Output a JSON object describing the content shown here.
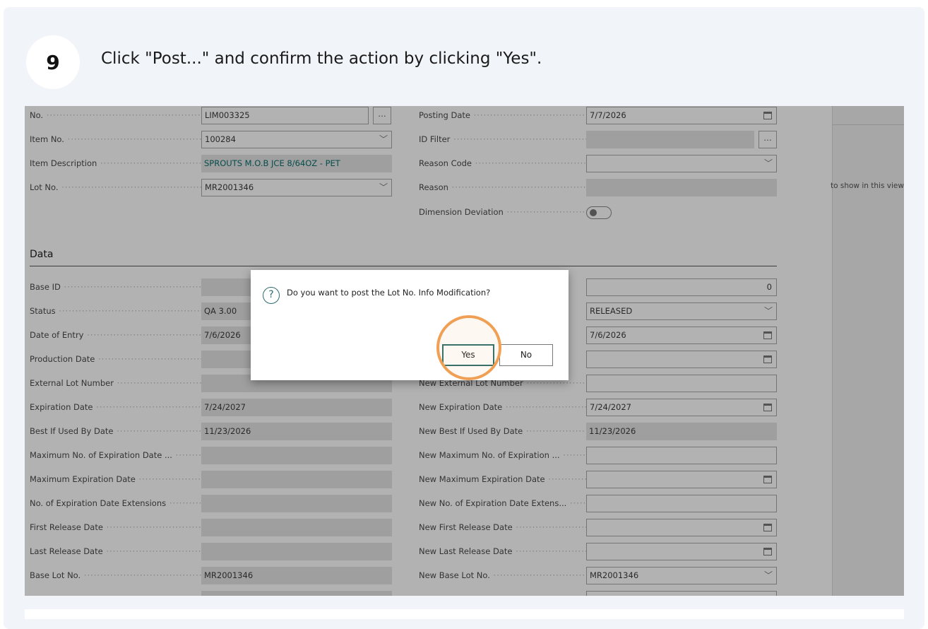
{
  "step": {
    "number": "9",
    "instruction": "Click \"Post...\" and confirm the action by clicking \"Yes\"."
  },
  "form": {
    "left_top": [
      {
        "label": "No.",
        "value": "LIM003325"
      },
      {
        "label": "Item No.",
        "value": "100284"
      },
      {
        "label": "Item Description",
        "value": "SPROUTS M.O.B JCE 8/64OZ - PET"
      },
      {
        "label": "Lot No.",
        "value": "MR2001346"
      }
    ],
    "right_top": [
      {
        "label": "Posting Date",
        "value": "7/7/2026"
      },
      {
        "label": "ID Filter",
        "value": ""
      },
      {
        "label": "Reason Code",
        "value": ""
      },
      {
        "label": "Reason",
        "value": ""
      },
      {
        "label": "Dimension Deviation",
        "value": ""
      }
    ],
    "section_title": "Data",
    "left_data": [
      {
        "label": "Base ID",
        "value": ""
      },
      {
        "label": "Status",
        "value": "QA 3.00"
      },
      {
        "label": "Date of Entry",
        "value": "7/6/2026"
      },
      {
        "label": "Production Date",
        "value": ""
      },
      {
        "label": "External Lot Number",
        "value": ""
      },
      {
        "label": "Expiration Date",
        "value": "7/24/2027"
      },
      {
        "label": "Best If Used By Date",
        "value": "11/23/2026"
      },
      {
        "label": "Maximum No. of Expiration Date ...",
        "value": ""
      },
      {
        "label": "Maximum Expiration Date",
        "value": ""
      },
      {
        "label": "No. of Expiration Date Extensions",
        "value": ""
      },
      {
        "label": "First Release Date",
        "value": ""
      },
      {
        "label": "Last Release Date",
        "value": ""
      },
      {
        "label": "Base Lot No.",
        "value": "MR2001346"
      }
    ],
    "right_data": [
      {
        "label": "",
        "value": "0"
      },
      {
        "label": "",
        "value": "RELEASED"
      },
      {
        "label": "",
        "value": "7/6/2026"
      },
      {
        "label": "",
        "value": ""
      },
      {
        "label": "New External Lot Number",
        "value": ""
      },
      {
        "label": "New Expiration Date",
        "value": "7/24/2027"
      },
      {
        "label": "New Best If Used By Date",
        "value": "11/23/2026"
      },
      {
        "label": "New Maximum No. of Expiration ...",
        "value": ""
      },
      {
        "label": "New Maximum Expiration Date",
        "value": ""
      },
      {
        "label": "New No. of Expiration Date Extens...",
        "value": ""
      },
      {
        "label": "New First Release Date",
        "value": ""
      },
      {
        "label": "New Last Release Date",
        "value": ""
      },
      {
        "label": "New Base Lot No.",
        "value": "MR2001346"
      }
    ],
    "side_panel_text": "to show in this view)"
  },
  "dialog": {
    "icon": "question-icon",
    "message": "Do you want to post the Lot No. Info Modification?",
    "yes_label": "Yes",
    "no_label": "No"
  },
  "colors": {
    "accent": "#2b6c6c",
    "highlight": "#f0a054",
    "card_bg": "#f1f4f9"
  }
}
